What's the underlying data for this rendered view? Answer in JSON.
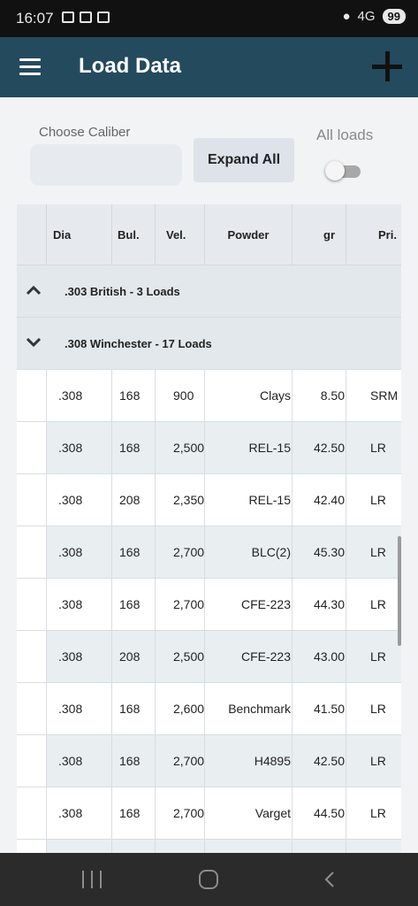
{
  "status_bar": {
    "time": "16:07",
    "network": "4G",
    "battery": "99"
  },
  "app_bar": {
    "title": "Load Data"
  },
  "controls": {
    "caliber_label": "Choose Caliber",
    "caliber_value": "",
    "expand_label": "Expand All",
    "all_loads_label": "All loads",
    "all_loads_on": false
  },
  "table": {
    "headers": [
      "Dia",
      "Bul.",
      "Vel.",
      "Powder",
      "gr",
      "Pri."
    ],
    "groups": [
      {
        "label": ".303 British - 3 Loads",
        "expanded": false
      },
      {
        "label": ".308 Winchester - 17 Loads",
        "expanded": true
      }
    ],
    "rows": [
      {
        "dia": ".308",
        "bul": "168",
        "vel": "900",
        "powder": "Clays",
        "gr": "8.50",
        "pri": "SRM"
      },
      {
        "dia": ".308",
        "bul": "168",
        "vel": "2,500",
        "powder": "REL-15",
        "gr": "42.50",
        "pri": "LR"
      },
      {
        "dia": ".308",
        "bul": "208",
        "vel": "2,350",
        "powder": "REL-15",
        "gr": "42.40",
        "pri": "LR"
      },
      {
        "dia": ".308",
        "bul": "168",
        "vel": "2,700",
        "powder": "BLC(2)",
        "gr": "45.30",
        "pri": "LR"
      },
      {
        "dia": ".308",
        "bul": "168",
        "vel": "2,700",
        "powder": "CFE-223",
        "gr": "44.30",
        "pri": "LR"
      },
      {
        "dia": ".308",
        "bul": "208",
        "vel": "2,500",
        "powder": "CFE-223",
        "gr": "43.00",
        "pri": "LR"
      },
      {
        "dia": ".308",
        "bul": "168",
        "vel": "2,600",
        "powder": "Benchmark",
        "gr": "41.50",
        "pri": "LR"
      },
      {
        "dia": ".308",
        "bul": "168",
        "vel": "2,700",
        "powder": "H4895",
        "gr": "42.50",
        "pri": "LR"
      },
      {
        "dia": ".308",
        "bul": "168",
        "vel": "2,700",
        "powder": "Varget",
        "gr": "44.50",
        "pri": "LR"
      },
      {
        "dia": "",
        "bul": "",
        "vel": "",
        "powder": "",
        "gr": "",
        "pri": ""
      }
    ]
  },
  "icons": {
    "menu": "hamburger-menu-icon",
    "add": "plus-icon",
    "group_collapse": "chevron-up-icon",
    "group_expand": "chevron-down-icon",
    "nav_recent": "recent-apps-icon",
    "nav_home": "home-icon",
    "nav_back": "back-icon"
  },
  "colors": {
    "app_bar": "#244a5e",
    "header_bg": "#e6eaee",
    "row_alt": "#e9eef1"
  }
}
